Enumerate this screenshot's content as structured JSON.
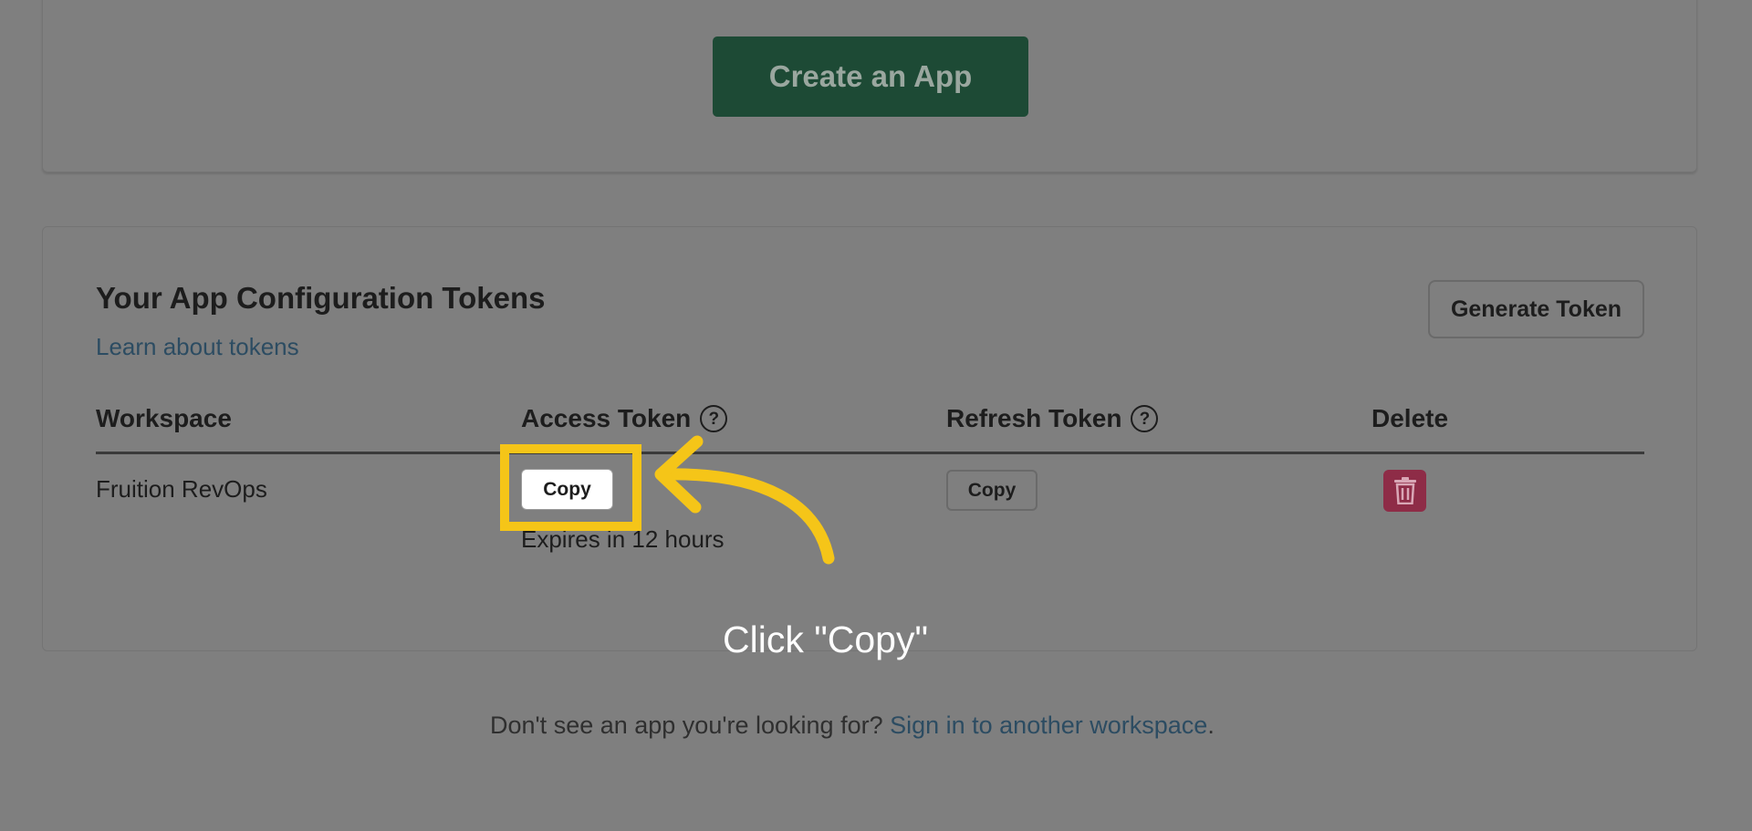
{
  "top_card": {
    "create_app_label": "Create an App"
  },
  "tokens_card": {
    "title": "Your App Configuration Tokens",
    "learn_link": "Learn about tokens",
    "generate_label": "Generate Token",
    "columns": {
      "workspace": "Workspace",
      "access_token": "Access Token",
      "refresh_token": "Refresh Token",
      "delete": "Delete"
    },
    "rows": [
      {
        "workspace": "Fruition RevOps",
        "access_copy_label": "Copy",
        "access_expiry": "Expires in 12 hours",
        "refresh_copy_label": "Copy"
      }
    ]
  },
  "annotation": {
    "instruction": "Click \"Copy\"",
    "color": "#f5c518"
  },
  "footer": {
    "prefix": "Don't see an app you're looking for? ",
    "link": "Sign in to another workspace",
    "suffix": "."
  },
  "icons": {
    "help": "question-circle-icon",
    "delete": "trash-icon",
    "arrow": "curved-arrow-icon"
  },
  "colors": {
    "overlay": "#7f7f7f",
    "create_button": "#1d4a35",
    "delete_button": "#8e2c47",
    "link": "#2c4c62"
  }
}
